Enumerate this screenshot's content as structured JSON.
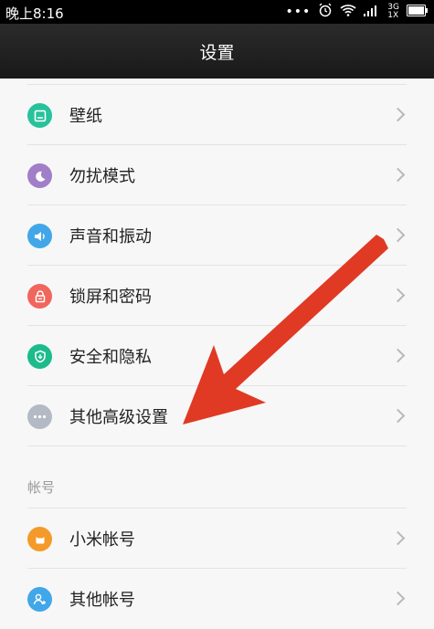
{
  "statusbar": {
    "time": "晚上8:16",
    "dots": "•••",
    "signal_label": "3G\n1X"
  },
  "header": {
    "title": "设置"
  },
  "items": [
    {
      "label": "壁纸",
      "color": "#27c29c",
      "icon": "wallpaper-icon"
    },
    {
      "label": "勿扰模式",
      "color": "#a07ec8",
      "icon": "moon-icon"
    },
    {
      "label": "声音和振动",
      "color": "#42a7e8",
      "icon": "speaker-icon"
    },
    {
      "label": "锁屏和密码",
      "color": "#f0665d",
      "icon": "lock-icon"
    },
    {
      "label": "安全和隐私",
      "color": "#1cbb8c",
      "icon": "shield-icon"
    },
    {
      "label": "其他高级设置",
      "color": "#b4bac3",
      "icon": "more-icon"
    }
  ],
  "account_section": {
    "title": "帐号",
    "items": [
      {
        "label": "小米帐号",
        "color": "#f39a2b",
        "icon": "mi-account-icon"
      },
      {
        "label": "其他帐号",
        "color": "#42a7e8",
        "icon": "add-user-icon"
      }
    ]
  },
  "annotation_color": "#e03a24"
}
